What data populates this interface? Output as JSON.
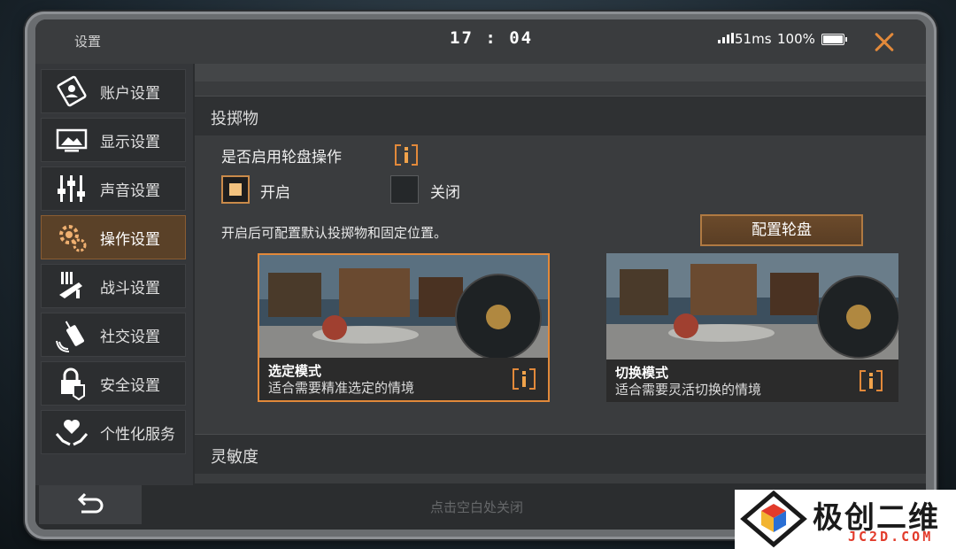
{
  "header": {
    "title": "设置",
    "time": "17 : 04",
    "ping": "51ms",
    "battery": "100%"
  },
  "sidebar": {
    "items": [
      {
        "label": "账户设置",
        "icon": "account-icon"
      },
      {
        "label": "显示设置",
        "icon": "display-icon"
      },
      {
        "label": "声音设置",
        "icon": "sound-icon"
      },
      {
        "label": "操作设置",
        "icon": "controls-icon",
        "active": true
      },
      {
        "label": "战斗设置",
        "icon": "combat-icon"
      },
      {
        "label": "社交设置",
        "icon": "social-icon"
      },
      {
        "label": "安全设置",
        "icon": "security-icon"
      },
      {
        "label": "个性化服务",
        "icon": "personalization-icon"
      }
    ]
  },
  "main": {
    "section_throwables": "投掷物",
    "wheel_question": "是否启用轮盘操作",
    "option_on": "开启",
    "option_off": "关闭",
    "selected_option": "开启",
    "hint": "开启后可配置默认投掷物和固定位置。",
    "config_button": "配置轮盘",
    "modes": [
      {
        "name": "选定模式",
        "desc": "适合需要精准选定的情境",
        "selected": true
      },
      {
        "name": "切换模式",
        "desc": "适合需要灵活切换的情境",
        "selected": false
      }
    ],
    "section_sensitivity": "灵敏度"
  },
  "footer": {
    "close_hint": "点击空白处关闭"
  },
  "watermark": {
    "cn": "极创二维",
    "en": "JC2D.COM"
  },
  "colors": {
    "accent": "#e2893a",
    "active_tab": "#5a4128",
    "panel": "#3a3c3e"
  }
}
